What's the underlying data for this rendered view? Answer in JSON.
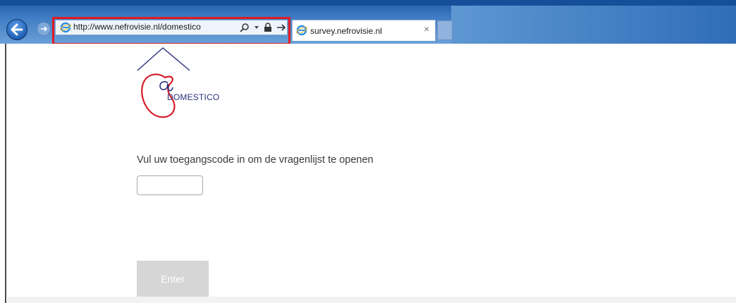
{
  "browser": {
    "address_url": "http://www.nefrovisie.nl/domestico",
    "tab_title": "survey.nefrovisie.nl",
    "tab_close": "×",
    "highlight_color": "#e11b22"
  },
  "page": {
    "logo_text": "DOMESTICO",
    "prompt": "Vul uw toegangscode in om de vragenlijst te openen",
    "code_input": {
      "value": "",
      "placeholder": ""
    },
    "enter_label": "Enter"
  }
}
